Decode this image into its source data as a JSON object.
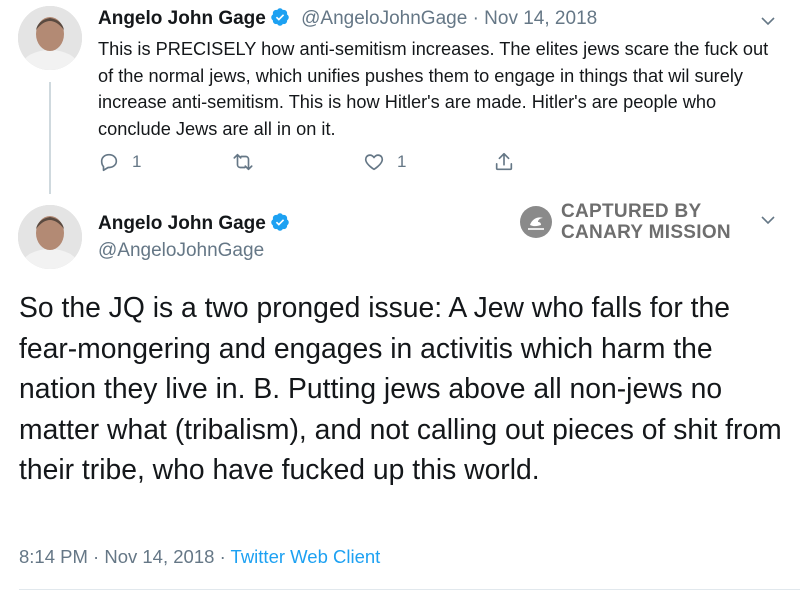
{
  "tweet1": {
    "author_name": "Angelo John Gage",
    "handle": "@AngeloJohnGage",
    "date": "Nov 14, 2018",
    "separator": "·",
    "text": "This is PRECISELY how anti-semitism increases. The elites jews scare the fuck out of the normal jews, which unifies pushes them to engage in things that wil surely increase anti-semitism. This is how Hitler's are made. Hitler's are people who conclude Jews are all in on it.",
    "actions": {
      "reply_count": "1",
      "retweet_count": "",
      "like_count": "1"
    }
  },
  "tweet2": {
    "author_name": "Angelo John Gage",
    "handle": "@AngeloJohnGage",
    "text": "So the JQ is a two pronged issue: A Jew who falls for the fear-mongering and engages in activitis which harm the nation they live in. B. Putting jews above all non-jews no matter what (tribalism), and not calling out pieces of shit from their tribe, who have fucked up this world.",
    "time": "8:14 PM",
    "date": "Nov 14, 2018",
    "separator": "·",
    "client": "Twitter Web Client"
  },
  "watermark": {
    "line1": "CAPTURED BY",
    "line2": "CANARY MISSION"
  },
  "colors": {
    "verified": "#1da1f2",
    "secondary_text": "#657786",
    "link": "#1da1f2"
  },
  "icons": [
    "verified-badge-icon",
    "chevron-down-icon",
    "reply-icon",
    "retweet-icon",
    "like-icon",
    "share-icon",
    "canary-mission-logo"
  ]
}
